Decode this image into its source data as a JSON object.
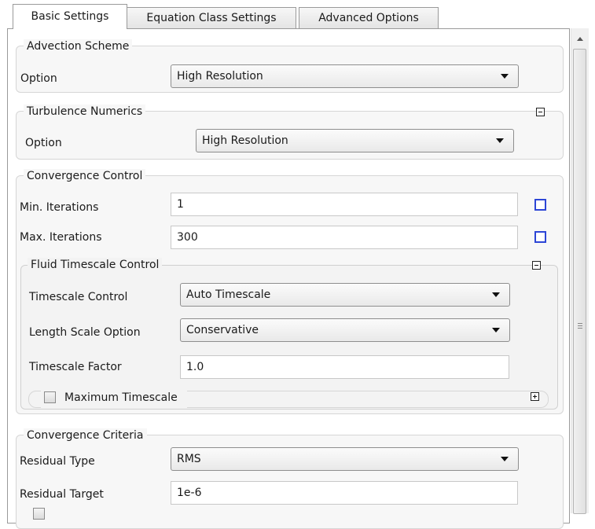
{
  "tabs": [
    {
      "label": "Basic Settings",
      "active": true
    },
    {
      "label": "Equation Class Settings",
      "active": false
    },
    {
      "label": "Advanced Options",
      "active": false
    }
  ],
  "advection": {
    "title": "Advection Scheme",
    "option_label": "Option",
    "option_value": "High Resolution"
  },
  "turbulence": {
    "title": "Turbulence Numerics",
    "option_label": "Option",
    "option_value": "High Resolution"
  },
  "convergence_control": {
    "title": "Convergence Control",
    "min_iter_label": "Min. Iterations",
    "min_iter_value": "1",
    "max_iter_label": "Max. Iterations",
    "max_iter_value": "300",
    "fluid_timescale": {
      "title": "Fluid Timescale Control",
      "timescale_control_label": "Timescale Control",
      "timescale_control_value": "Auto Timescale",
      "length_scale_label": "Length Scale Option",
      "length_scale_value": "Conservative",
      "timescale_factor_label": "Timescale Factor",
      "timescale_factor_value": "1.0",
      "maximum_timescale_label": "Maximum Timescale",
      "maximum_timescale_checked": false
    }
  },
  "convergence_criteria": {
    "title": "Convergence Criteria",
    "residual_type_label": "Residual Type",
    "residual_type_value": "RMS",
    "residual_target_label": "Residual Target",
    "residual_target_value": "1e-6"
  },
  "colors": {
    "accent_checkbox_border": "#2d46d6",
    "group_background": "#f7f7f7",
    "panel_border": "#9a9a9a"
  }
}
